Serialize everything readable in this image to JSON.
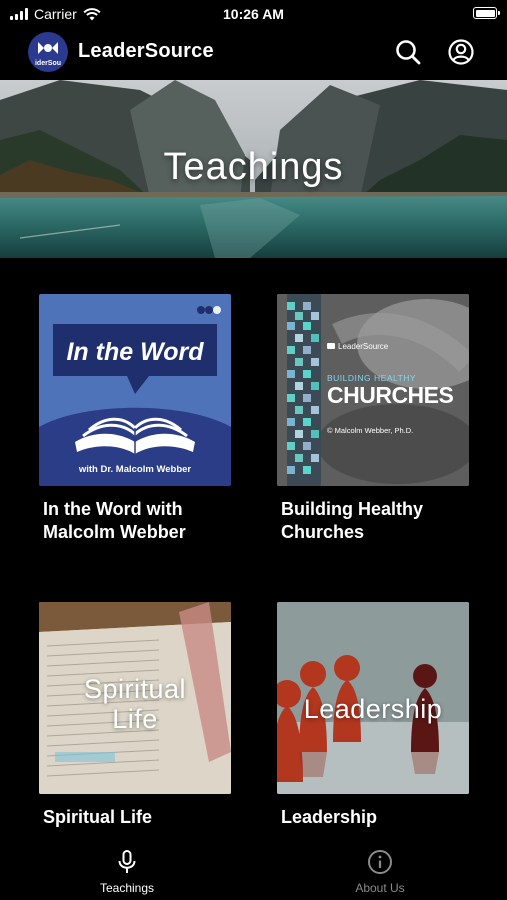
{
  "status_bar": {
    "carrier": "Carrier",
    "time": "10:26 AM"
  },
  "app": {
    "title": "LeaderSource",
    "logo_text": "iderSou"
  },
  "hero": {
    "title": "Teachings"
  },
  "cards": [
    {
      "title": "In the Word with Malcolm Webber",
      "art_title": "In the Word",
      "art_subtitle": "with Dr. Malcolm Webber"
    },
    {
      "title": "Building Healthy Churches",
      "art_brand": "LeaderSource",
      "art_kicker": "BUILDING HEALTHY",
      "art_title": "CHURCHES",
      "art_author": "© Malcolm Webber, Ph.D."
    },
    {
      "title": "Spiritual Life",
      "art_line1": "Spiritual",
      "art_line2": "Life"
    },
    {
      "title": "Leadership",
      "art_title": "Leadership"
    }
  ],
  "tabs": [
    {
      "label": "Teachings",
      "icon": "microphone-icon",
      "active": true
    },
    {
      "label": "About Us",
      "icon": "info-icon",
      "active": false
    }
  ],
  "colors": {
    "background": "#000000",
    "active_tab": "#ffffff",
    "inactive_tab": "#8a8a8a",
    "logo_bg": "#2b3a8f"
  }
}
